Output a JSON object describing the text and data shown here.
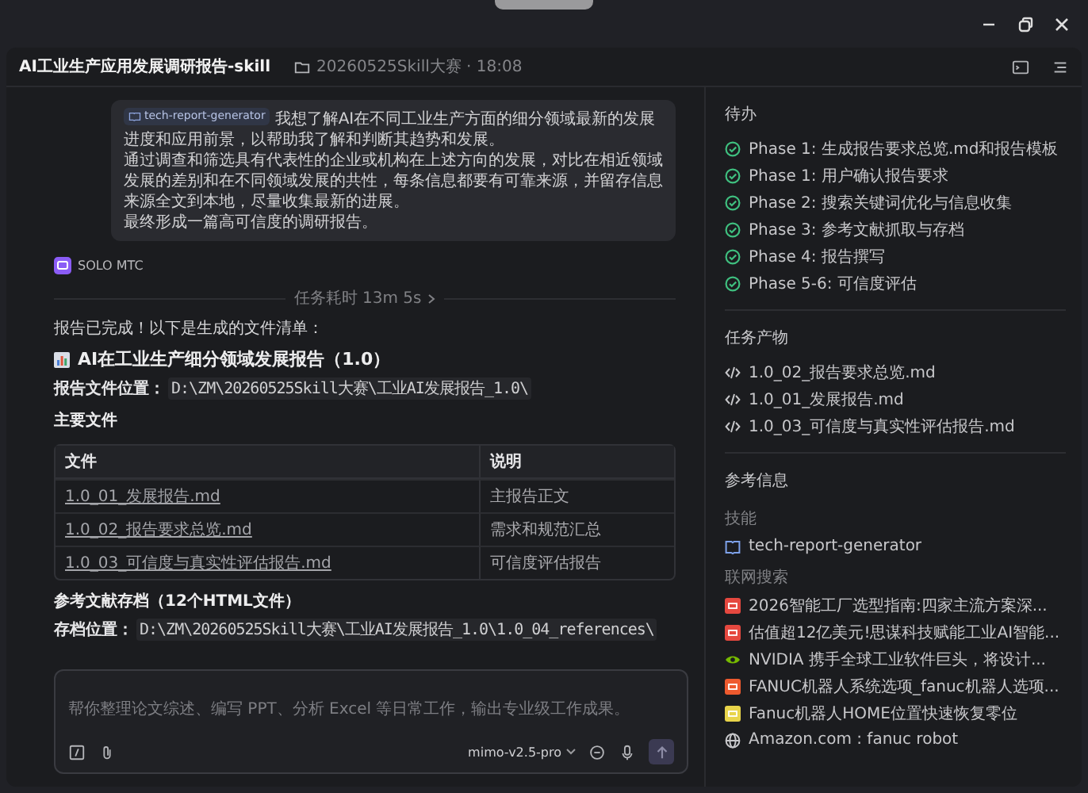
{
  "header": {
    "title": "AI工业生产应用发展调研报告-skill",
    "meta": "20260525Skill大赛 · 18:08"
  },
  "user_message": {
    "skill_tag": "tech-report-generator",
    "paragraphs": [
      "我想了解AI在不同工业生产方面的细分领域最新的发展进度和应用前景，以帮助我了解和判断其趋势和发展。",
      "通过调查和筛选具有代表性的企业或机构在上述方向的发展，对比在相近领域发展的差别和在不同领域发展的共性，每条信息都要有可靠来源，并留存信息来源全文到本地，尽量收集最新的进展。",
      "最终形成一篇高可信度的调研报告。"
    ]
  },
  "agent": {
    "name": "SOLO MTC"
  },
  "duration": "任务耗时 13m 5s",
  "reply": {
    "intro": "报告已完成！以下是生成的文件清单：",
    "title": "AI在工业生产细分领域发展报告（1.0）",
    "location_label": "报告文件位置：",
    "location_path": "D:\\ZM\\20260525Skill大赛\\工业AI发展报告_1.0\\",
    "files_heading": "主要文件",
    "table": {
      "columns": [
        "文件",
        "说明"
      ],
      "rows": [
        [
          "1.0_01_发展报告.md",
          "主报告正文"
        ],
        [
          "1.0_02_报告要求总览.md",
          "需求和规范汇总"
        ],
        [
          "1.0_03_可信度与真实性评估报告.md",
          "可信度评估报告"
        ]
      ]
    },
    "refs_heading": "参考文献存档（12个HTML文件）",
    "refs_label": "存档位置：",
    "refs_path": "D:\\ZM\\20260525Skill大赛\\工业AI发展报告_1.0\\1.0_04_references\\"
  },
  "composer": {
    "placeholder": "帮你整理论文综述、编写 PPT、分析 Excel 等日常工作，输出专业级工作成果。",
    "model": "mimo-v2.5-pro"
  },
  "sidebar": {
    "todo": {
      "title": "待办",
      "items": [
        {
          "label": "Phase 1: 生成报告要求总览.md和报告模板",
          "done": true
        },
        {
          "label": "Phase 1: 用户确认报告要求",
          "done": true
        },
        {
          "label": "Phase 2: 搜索关键词优化与信息收集",
          "done": true
        },
        {
          "label": "Phase 3: 参考文献抓取与存档",
          "done": true
        },
        {
          "label": "Phase 4: 报告撰写",
          "done": true
        },
        {
          "label": "Phase 5-6: 可信度评估",
          "done": true
        }
      ]
    },
    "outputs": {
      "title": "任务产物",
      "items": [
        "1.0_02_报告要求总览.md",
        "1.0_01_发展报告.md",
        "1.0_03_可信度与真实性评估报告.md"
      ]
    },
    "reference": {
      "title": "参考信息",
      "skills_label": "技能",
      "skills": [
        "tech-report-generator"
      ],
      "search_label": "联网搜索",
      "results": [
        {
          "title": "2026智能工厂选型指南:四家主流方案深...",
          "kind": "favicon",
          "color": "#e5483f"
        },
        {
          "title": "估值超12亿美元!思谋科技赋能工业AI智能...",
          "kind": "favicon",
          "color": "#e5483f"
        },
        {
          "title": "NVIDIA 携手全球工业软件巨头，将设计...",
          "kind": "nvidia"
        },
        {
          "title": "FANUC机器人系统选项_fanuc机器人选项...",
          "kind": "favicon",
          "color": "#ee5a2e"
        },
        {
          "title": "Fanuc机器人HOME位置快速恢复零位",
          "kind": "favicon",
          "color": "#e8d44a"
        },
        {
          "title": "Amazon.com : fanuc robot",
          "kind": "globe"
        }
      ]
    }
  }
}
